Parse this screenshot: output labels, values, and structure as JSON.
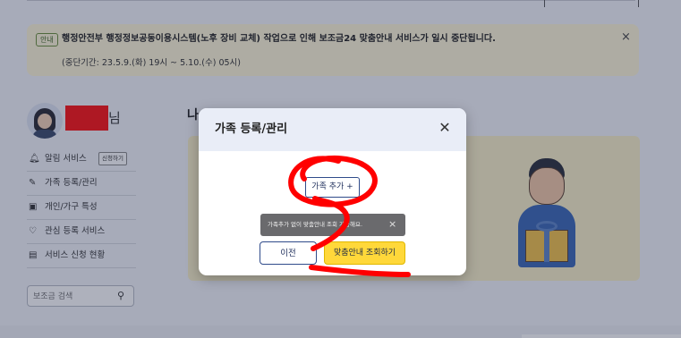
{
  "notice": {
    "tag": "안내",
    "message": "행정안전부 행정정보공동이용시스템(노후 장비 교체) 작업으로 인해 보조금24 맞춤안내 서비스가 일시 중단됩니다.",
    "period": "(중단기간: 23.5.9.(화) 19시 ~ 5.10.(수) 05시)",
    "close": "×"
  },
  "profile": {
    "name_suffix": "님"
  },
  "sidebar": {
    "items": [
      {
        "icon": "bell-icon",
        "glyph": "🔔︎",
        "label": "알림 서비스",
        "button": "신청하기"
      },
      {
        "icon": "pencil-icon",
        "glyph": "✎",
        "label": "가족 등록/관리"
      },
      {
        "icon": "household-icon",
        "glyph": "▣",
        "label": "개인/가구 특성"
      },
      {
        "icon": "heart-icon",
        "glyph": "♡",
        "label": "관심 등록 서비스"
      },
      {
        "icon": "clipboard-icon",
        "glyph": "▤",
        "label": "서비스 신청 현황"
      }
    ],
    "search": {
      "placeholder": "보조금 검색",
      "icon": "search-icon",
      "glyph": "⚲"
    }
  },
  "main": {
    "title": "나"
  },
  "modal": {
    "title": "가족 등록/관리",
    "close": "✕",
    "add_button": "가족 추가 +",
    "prev_button": "이전",
    "inquire_button": "맞춤안내 조회하기"
  },
  "toast": {
    "message": "가족추가 없이 맞춤안내 조회 가능해요.",
    "close": "×"
  },
  "colors": {
    "notice_bg": "#fff8d8",
    "modal_header_bg": "#e9edf7",
    "primary_blue": "#2f4b8a",
    "accent_yellow": "#ffd83a",
    "annotation_red": "#ff0000",
    "redaction_red": "#ff1111"
  }
}
